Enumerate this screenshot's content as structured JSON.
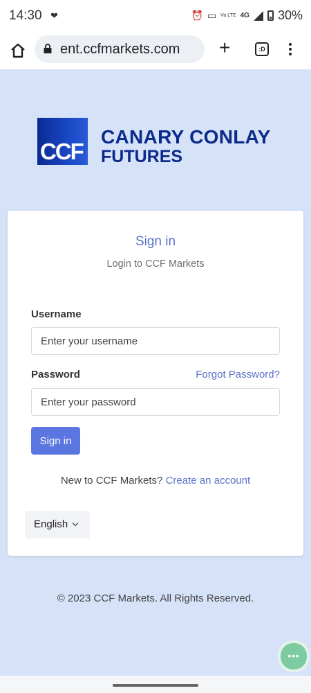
{
  "status_bar": {
    "time": "14:30",
    "network": "4G",
    "volte": "Vo LTE",
    "battery": "30%",
    "icons": [
      "heart-rate-icon",
      "alarm-icon",
      "vibrate-icon",
      "signal-icon",
      "battery-icon"
    ]
  },
  "browser": {
    "url": "ent.ccfmarkets.com",
    "tab_count": ":D",
    "icons": [
      "home-icon",
      "lock-icon",
      "new-tab-icon",
      "tabs-icon",
      "menu-icon"
    ]
  },
  "logo": {
    "abbr": "CCF",
    "line1": "CANARY CONLAY",
    "line2": "FUTURES"
  },
  "login": {
    "title": "Sign in",
    "subtitle": "Login to CCF Markets",
    "username_label": "Username",
    "username_placeholder": "Enter your username",
    "password_label": "Password",
    "forgot_link": "Forgot Password?",
    "password_placeholder": "Enter your password",
    "submit_label": "Sign in",
    "new_to_text": "New to CCF Markets?",
    "create_account_link": "Create an account",
    "language": "English"
  },
  "footer": {
    "copyright": "© 2023 CCF Markets. All Rights Reserved."
  },
  "chat": {
    "icon": "chat-bubble-icon",
    "glyph": "•••"
  },
  "colors": {
    "page_bg": "#d5e2f8",
    "accent": "#5a72c9",
    "button": "#5b76e1",
    "brand_navy": "#0b2a8a",
    "chat": "#7ccba1"
  }
}
